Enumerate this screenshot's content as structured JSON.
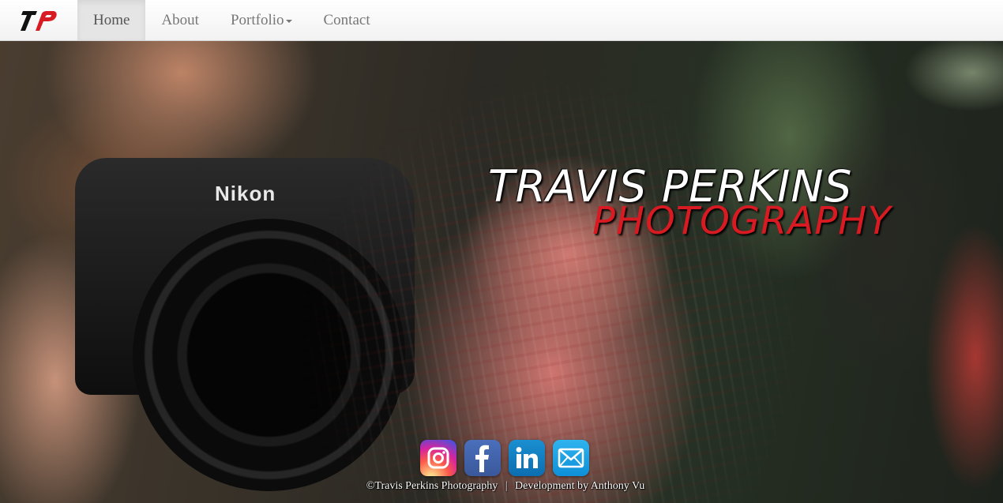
{
  "nav": {
    "logo_alt": "TP",
    "items": [
      {
        "label": "Home",
        "active": true
      },
      {
        "label": "About",
        "active": false
      },
      {
        "label": "Portfolio",
        "active": false,
        "dropdown": true
      },
      {
        "label": "Contact",
        "active": false
      }
    ]
  },
  "hero": {
    "title_line1": "TRAVIS PERKINS",
    "title_line2": "PHOTOGRAPHY",
    "camera_brand": "Nikon",
    "accent_color": "#d81b22"
  },
  "social": [
    {
      "name": "instagram-icon"
    },
    {
      "name": "facebook-icon"
    },
    {
      "name": "linkedin-icon"
    },
    {
      "name": "email-icon"
    }
  ],
  "footer": {
    "copyright": "©Travis Perkins Photography",
    "separator": "|",
    "credit": "Development by Anthony Vu"
  }
}
